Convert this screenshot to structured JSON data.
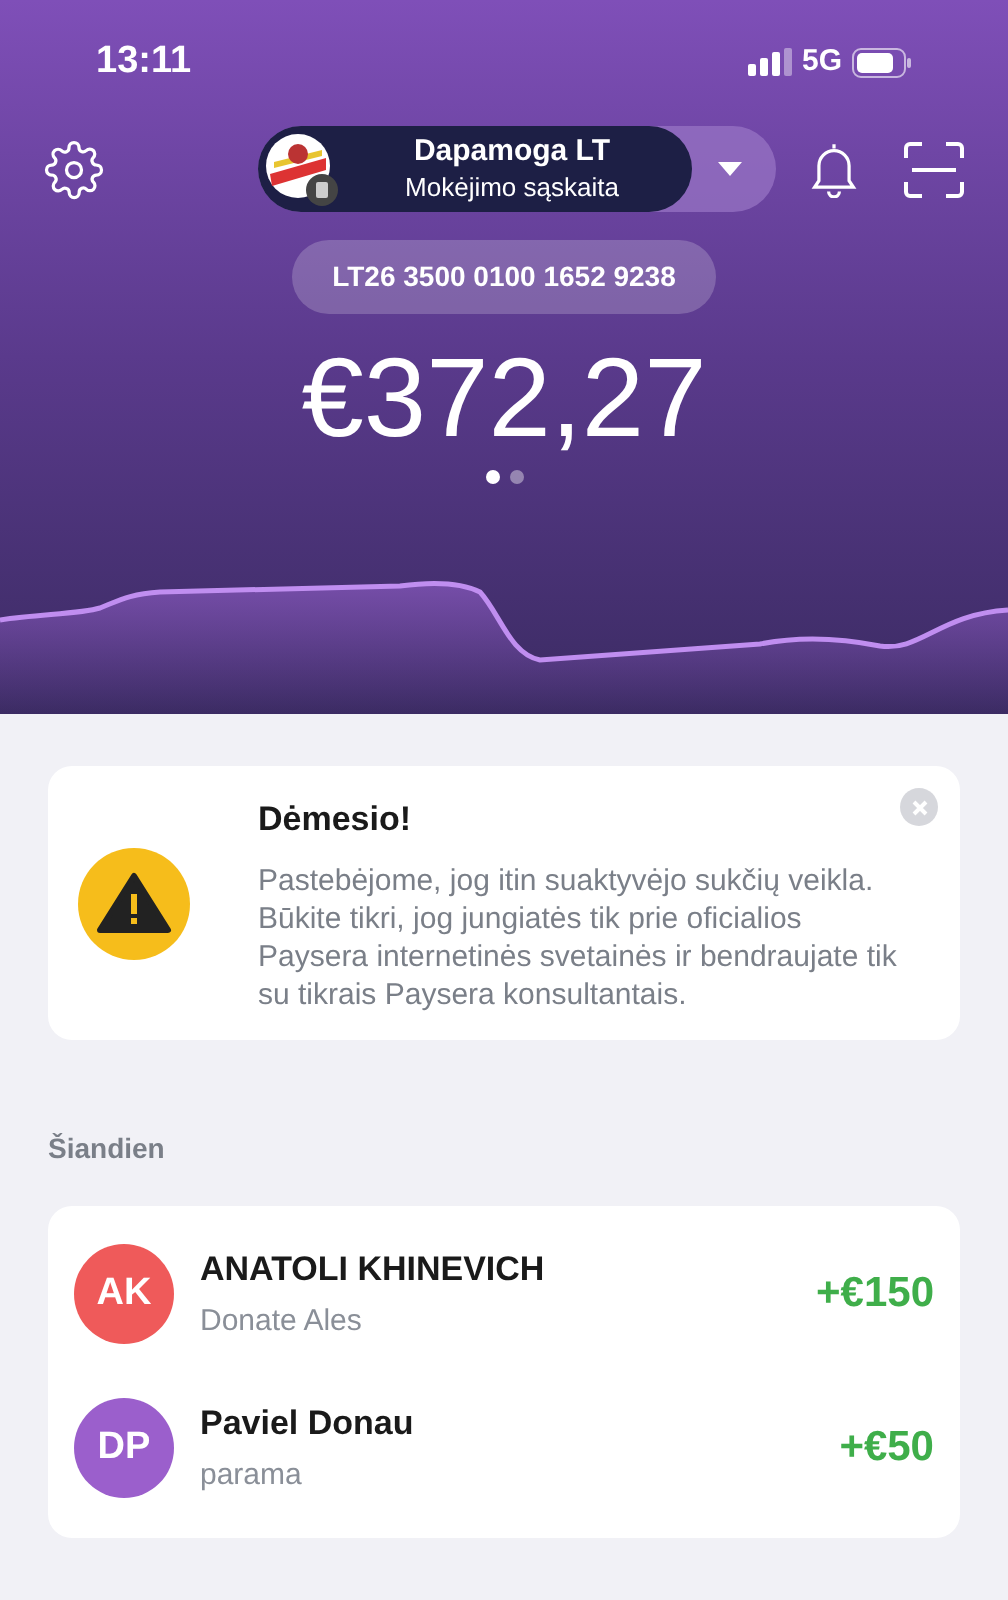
{
  "status_bar": {
    "time": "13:11",
    "network": "5G"
  },
  "account": {
    "name": "Dapamoga LT",
    "type": "Mokėjimo sąskaita"
  },
  "iban": "LT26 3500 0100 1652 9238",
  "balance": "€372,27",
  "pager": [
    {
      "selected": true
    },
    {
      "selected": false
    }
  ],
  "alert": {
    "title": "Dėmesio!",
    "message": "Pastebėjome, jog itin suaktyvėjo sukčių veikla. Būkite tikri, jog jungiatės tik prie oficialios Paysera internetinės svetainės ir bendraujate tik su tikrais Paysera konsultantais."
  },
  "section_title": "Šiandien",
  "transactions": [
    {
      "initials": "AK",
      "color": "#ef5a5a",
      "name": "ANATOLI KHINEVICH",
      "description": "Donate Ales",
      "amount": "+€150"
    },
    {
      "initials": "DP",
      "color": "#9b5fcc",
      "name": "Paviel Donau",
      "description": "parama",
      "amount": "+€50"
    }
  ]
}
